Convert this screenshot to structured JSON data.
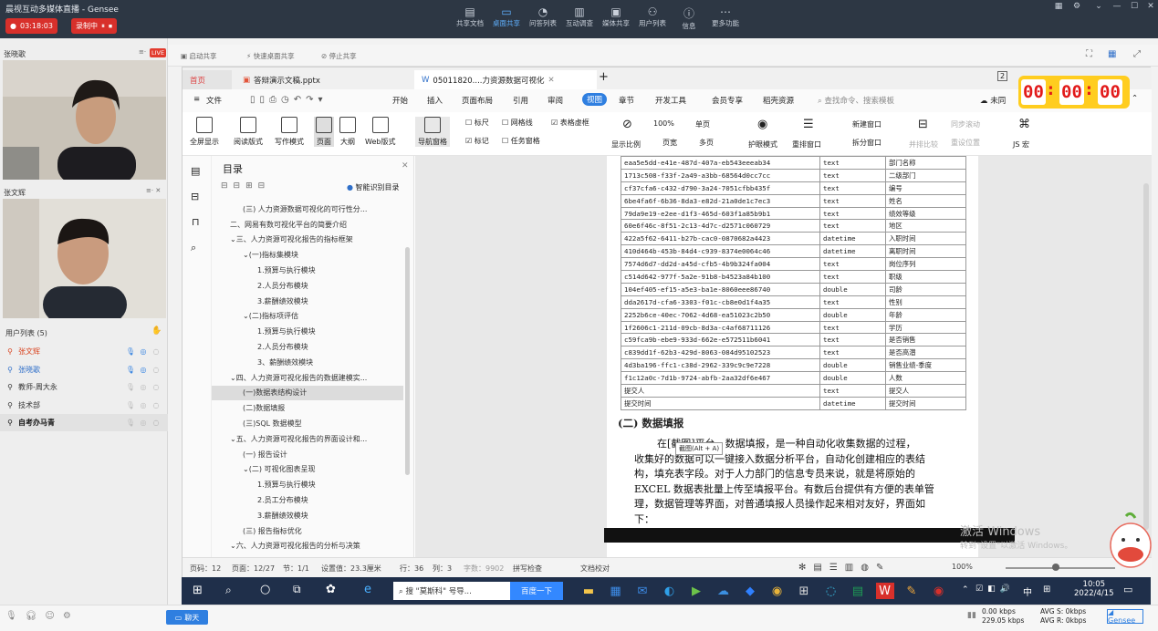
{
  "app": {
    "title": "晨视互动多媒体直播 - Gensee",
    "timer": "03:18:03",
    "recording": "录制中"
  },
  "toolbar": {
    "items": [
      "共享文档",
      "桌面共享",
      "问答列表",
      "互动调查",
      "媒体共享",
      "用户列表",
      "信息",
      "更多功能"
    ],
    "active": "桌面共享"
  },
  "videos": [
    {
      "name": "张晓歌",
      "badge": "LIVE"
    },
    {
      "name": "张文辉"
    }
  ],
  "users": {
    "header": "用户列表 (5)",
    "list": [
      {
        "name": "张文辉",
        "color": "#d9431f",
        "bold": false
      },
      {
        "name": "张晓歌",
        "color": "#2f6fc9",
        "bold": false
      },
      {
        "name": "教师-周大永",
        "color": "#333333",
        "bold": false
      },
      {
        "name": "技术部",
        "color": "#333333",
        "bold": false
      },
      {
        "name": "自考办马青",
        "color": "#111111",
        "bold": true
      }
    ]
  },
  "share": {
    "start": "启动共享",
    "quick": "快速桌面共享",
    "stop": "停止共享"
  },
  "wps": {
    "tabs": [
      {
        "label": "首页"
      },
      {
        "label": "答辩演示文稿.pptx"
      },
      {
        "label": "05011820....力资源数据可视化"
      }
    ],
    "menu": [
      "文件",
      "开始",
      "插入",
      "页面布局",
      "引用",
      "审阅",
      "视图",
      "章节",
      "开发工具",
      "会员专享",
      "稻壳资源"
    ],
    "menu_active": "视图",
    "search_placeholder": "查找命令、搜索模板",
    "cloud": "未同",
    "ribbon": {
      "big": [
        "全屏显示",
        "阅读版式",
        "写作模式",
        "页面",
        "大纲",
        "Web版式",
        "导航窗格"
      ],
      "checks": [
        "标尺",
        "网格线",
        "表格虚框",
        "标记",
        "任务窗格"
      ],
      "right": [
        "显示比例",
        "100%",
        "单页",
        "页宽",
        "多页",
        "护眼模式",
        "重排窗口",
        "新建窗口",
        "拆分窗口",
        "并排比较",
        "同步滚动",
        "重设位置",
        "JS 宏"
      ]
    },
    "toc_title": "目录",
    "toc_smart": "智能识别目录",
    "toc": [
      "(三) 人力资源数据可视化的可行性分...",
      "二、网易有数可视化平台的简要介绍",
      "三、人力资源可视化报告的指标框架",
      "(一)指标集模块",
      "1.预算与执行模块",
      "2.人员分布模块",
      "3.薪酬绩效模块",
      "(二)指标项评估",
      "1.预算与执行模块",
      "2.人员分布模块",
      "3、薪酬绩效模块",
      "四、人力资源可视化报告的数据建模实...",
      "(一)数据表结构设计",
      "(二)数据填报",
      "(三)SQL 数据模型",
      "五、人力资源可视化报告的界面设计和...",
      "(一) 报告设计",
      "(二) 可视化图表呈现",
      "1.预算与执行模块",
      "2.员工分布模块",
      "3.薪酬绩效模块",
      "(三) 报告指标优化",
      "六、人力资源可视化报告的分析与决策"
    ],
    "table": [
      [
        "eaa5e5dd-e41e-487d-407a-eb543eeeab34",
        "text",
        "部门名称"
      ],
      [
        "1713c508-f33f-2a49-a3bb-68564d0cc7cc",
        "text",
        "二级部门"
      ],
      [
        "cf37cfa6-c432-d790-3a24-7051cfbb435f",
        "text",
        "编号"
      ],
      [
        "6be4fa6f-6b36-8da3-e82d-21a0de1c7ec3",
        "text",
        "姓名"
      ],
      [
        "79da9e19-e2ee-d1f3-465d-603f1a85b9b1",
        "text",
        "绩效等级"
      ],
      [
        "60e6f46c-8f51-2c13-4d7c-d2571c060729",
        "text",
        "地区"
      ],
      [
        "422a5f62-6411-b27b-cac0-0870682a4423",
        "datetime",
        "入职时间"
      ],
      [
        "410d464b-453b-84d4-c939-8374e0064c46",
        "datetime",
        "离职时间"
      ],
      [
        "7574d6d7-dd2d-a45d-cfb5-4b9b324fa004",
        "text",
        "岗位序列"
      ],
      [
        "c514d642-977f-5a2e-91b8-b4523a84b100",
        "text",
        "职级"
      ],
      [
        "104ef405-ef15-a5e3-ba1e-8060eee86740",
        "double",
        "司龄"
      ],
      [
        "dda2617d-cfa6-3303-f01c-cb8e0d1f4a35",
        "text",
        "性别"
      ],
      [
        "2252b6ce-40ec-7062-4d68-ea51023c2b50",
        "double",
        "年龄"
      ],
      [
        "1f2606c1-211d-09cb-8d3a-c4af68711126",
        "text",
        "学历"
      ],
      [
        "c59fca9b-ebe9-933d-662e-e572511b6041",
        "text",
        "是否销售"
      ],
      [
        "c839dd1f-62b3-429d-8063-084d95102523",
        "text",
        "是否高潜"
      ],
      [
        "4d3ba196-ffc1-c38d-2962-339c9c9e7228",
        "double",
        "销售业绩-季度"
      ],
      [
        "f1c12a0c-7d1b-9724-abfb-2aa32df6e467",
        "double",
        "人数"
      ],
      [
        "提交人",
        "text",
        "提交人"
      ],
      [
        "提交时间",
        "datetime",
        "提交时间"
      ]
    ],
    "section_title": "(二) 数据填报",
    "tooltip": "截图(Alt + A)",
    "paragraph": [
      "在[截图]平台，数据填报，是一种自动化收集数据的过程，",
      "收集好的数据可以一键接入数据分析平台，自动化创建相应的表结",
      "构，填充表字段。对于人力部门的信息专员来说，就是将原始的",
      "EXCEL 数据表批量上传至填报平台。有数后台提供有方便的表单管",
      "理，数据管理等界面，对普通填报人员操作起来相对友好，界面如",
      "下："
    ],
    "status": {
      "page": "页码：12",
      "pages": "页面：12/27",
      "section": "节：1/1",
      "setting": "设置值：23.3厘米",
      "row": "行：36",
      "col": "列：3",
      "words": "字数：9902",
      "spell": "拼写检查",
      "doc_check": "文档校对",
      "zoom": "100%"
    }
  },
  "timer": {
    "h": "00",
    "m": "00",
    "s": "00"
  },
  "watermark": {
    "line1": "激活 Windows",
    "line2": "转到\"设置\"以激活 Windows。"
  },
  "taskbar": {
    "search": "搜 \"莫斯科\" 号导...",
    "baidu": "百度一下",
    "clock": "10:05",
    "date": "2022/4/15",
    "lang": "中"
  },
  "bottom": {
    "chat": "聊天",
    "up": "0.00 kbps",
    "down": "229.05 kbps",
    "avg_s": "AVG S: 0kbps",
    "avg_r": "AVG R: 0kbps"
  }
}
